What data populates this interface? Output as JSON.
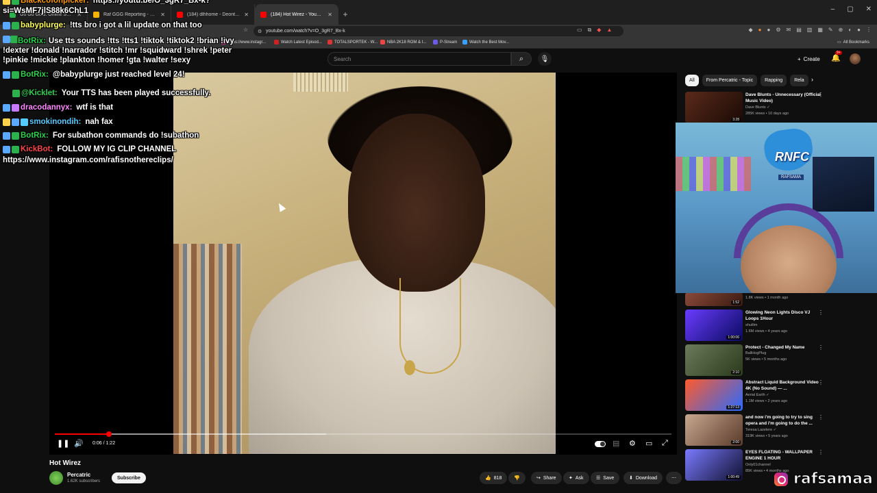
{
  "browser": {
    "tabs": [
      {
        "title": "Go Go Gold: Online Social Casino",
        "color": "#2bb24c"
      },
      {
        "title": "Raf GGG Reporting - Google Drive",
        "color": "#f4b400"
      },
      {
        "title": "(184) dlhhome - Deontae 2 - YouTube",
        "color": "#ff0000"
      },
      {
        "title": "(184) Hot Wirez - YouTube",
        "color": "#ff0000"
      }
    ],
    "url": "youtube.com/watch?v=O_3gR7_Bx-k",
    "window_controls": [
      "–",
      "▢",
      "✕"
    ],
    "bookmarks": [
      {
        "label": "https://www.instagr...",
        "color": "#c13584"
      },
      {
        "label": "Watch Latest Episod...",
        "color": "#cc2222"
      },
      {
        "label": "TOTALSPORTEK - W...",
        "color": "#d33"
      },
      {
        "label": "NBA 2K18 ROM & I...",
        "color": "#e44"
      },
      {
        "label": "P-Stream",
        "color": "#6c5ce7"
      },
      {
        "label": "Watch the Best Mov...",
        "color": "#3aa0ff"
      }
    ],
    "all_bookmarks": "All Bookmarks"
  },
  "youtube": {
    "search_placeholder": "Search",
    "create_label": "Create",
    "notif_badge": "9+"
  },
  "player": {
    "time": "0:06 / 1:22",
    "progress": 0.088,
    "buffered": 0.44
  },
  "video": {
    "title": "Hot Wirez",
    "channel": "Percatric",
    "subs": "1.62K subscribers",
    "subscribe": "Subscribe",
    "likes": "818",
    "share": "Share",
    "ask": "Ask",
    "save": "Save",
    "download": "Download"
  },
  "chips": [
    "All",
    "From Percatric - Topic",
    "Rapping",
    "Rela"
  ],
  "recs": [
    {
      "title": "Dave Blunts - Unnecessary (Official Music Video)",
      "channel": "Dave Blunts ✓",
      "meta": "285K views • 10 days ago",
      "dur": "3:28",
      "c1": "#5a2a1a",
      "c2": "#1a0a05"
    },
    {
      "title": "",
      "channel": "",
      "meta": "1.8K views • 1 month ago",
      "dur": "1:52",
      "c1": "#8a4a3a",
      "c2": "#3a1a10"
    },
    {
      "title": "Glowing Neon Lights Disco VJ Loops 1Hour",
      "channel": "shutlim",
      "meta": "1.6M views • 4 years ago",
      "dur": "1:00:06",
      "c1": "#6a3cff",
      "c2": "#0a0a60"
    },
    {
      "title": "Protect - Changed My Name",
      "channel": "BallHogPlug",
      "meta": "5K views • 5 months ago",
      "dur": "2:10",
      "c1": "#6a7a5a",
      "c2": "#2a3a1a"
    },
    {
      "title": "Abstract Liquid Background Video 4K (No Sound) — ...",
      "channel": "Aerial Earth ✓",
      "meta": "1.1M views • 2 years ago",
      "dur": "1:27:13",
      "c1": "#ff5a2a",
      "c2": "#2a6aff"
    },
    {
      "title": "and now i'm going to try to sing opera and i'm going to do the ...",
      "channel": "Teresa Lazelere ✓",
      "meta": "319K views • 5 years ago",
      "dur": "2:00",
      "c1": "#c8a890",
      "c2": "#5a3a2a"
    },
    {
      "title": "EYES FLOATING - WALLPAPER ENGINE 1 HOUR",
      "channel": "Only01channel",
      "meta": "85K views • 4 months ago",
      "dur": "1:00:49",
      "c1": "#7a7aff",
      "c2": "#101030"
    }
  ],
  "webcam": {
    "sign": "RNFC",
    "tag": "RAFSAMA"
  },
  "watermark": "rafsamaa",
  "chat": [
    {
      "user": "Blackcofonpicker:",
      "ucolor": "#ff9a00",
      "msg": "https://youtu.be/O_3gR7_Bx-k?",
      "badges": [
        "#ffd24a",
        "#2bb24c"
      ]
    },
    {
      "user": "",
      "ucolor": "#fff",
      "msg": "si=WsMF7jlS88k6ChL1",
      "badges": []
    },
    {
      "user": "babyplurge:",
      "ucolor": "#ffff55",
      "msg": "!tts bro i got a lil update on that too",
      "badges": [
        "#5aa8ff",
        "#2bb24c"
      ]
    },
    {
      "user": "BotRix:",
      "ucolor": "#2bd24c",
      "msg": "Use tts sounds !tts !tts1 !tiktok !tiktok2 !brian !ivy !dexter !donald !narrador !stitch !mr !squidward !shrek !peter !pinkie !mickie !plankton !homer !gta !walter !sexy",
      "badges": [
        "#5aa8ff",
        "#2bb24c"
      ]
    },
    {
      "user": "BotRix:",
      "ucolor": "#2bd24c",
      "msg": "@babyplurge just reached level 24!",
      "badges": [
        "#5aa8ff",
        "#2bb24c"
      ]
    },
    {
      "user": "@Kicklet:",
      "ucolor": "#2bd24c",
      "msg": "Your TTS has been played successfully.",
      "badges": [
        "#2bb24c"
      ]
    },
    {
      "user": "dracodannyx:",
      "ucolor": "#ff88ff",
      "msg": "wtf is that",
      "badges": [
        "#5aa8ff",
        "#c879ff"
      ]
    },
    {
      "user": "smokinondih:",
      "ucolor": "#55ccff",
      "msg": "nah fax",
      "badges": [
        "#ffd24a",
        "#5aa8ff",
        "#55ccff"
      ]
    },
    {
      "user": "BotRix:",
      "ucolor": "#2bd24c",
      "msg": "For subathon commands do !subathon",
      "badges": [
        "#5aa8ff",
        "#2bb24c"
      ]
    },
    {
      "user": "KickBot:",
      "ucolor": "#ff4444",
      "msg": "FOLLOW MY IG CLIP CHANNEL",
      "badges": [
        "#5aa8ff",
        "#2bb24c"
      ]
    },
    {
      "user": "",
      "ucolor": "#fff",
      "msg": "https://www.instagram.com/rafisnotherecIips/",
      "badges": []
    }
  ]
}
